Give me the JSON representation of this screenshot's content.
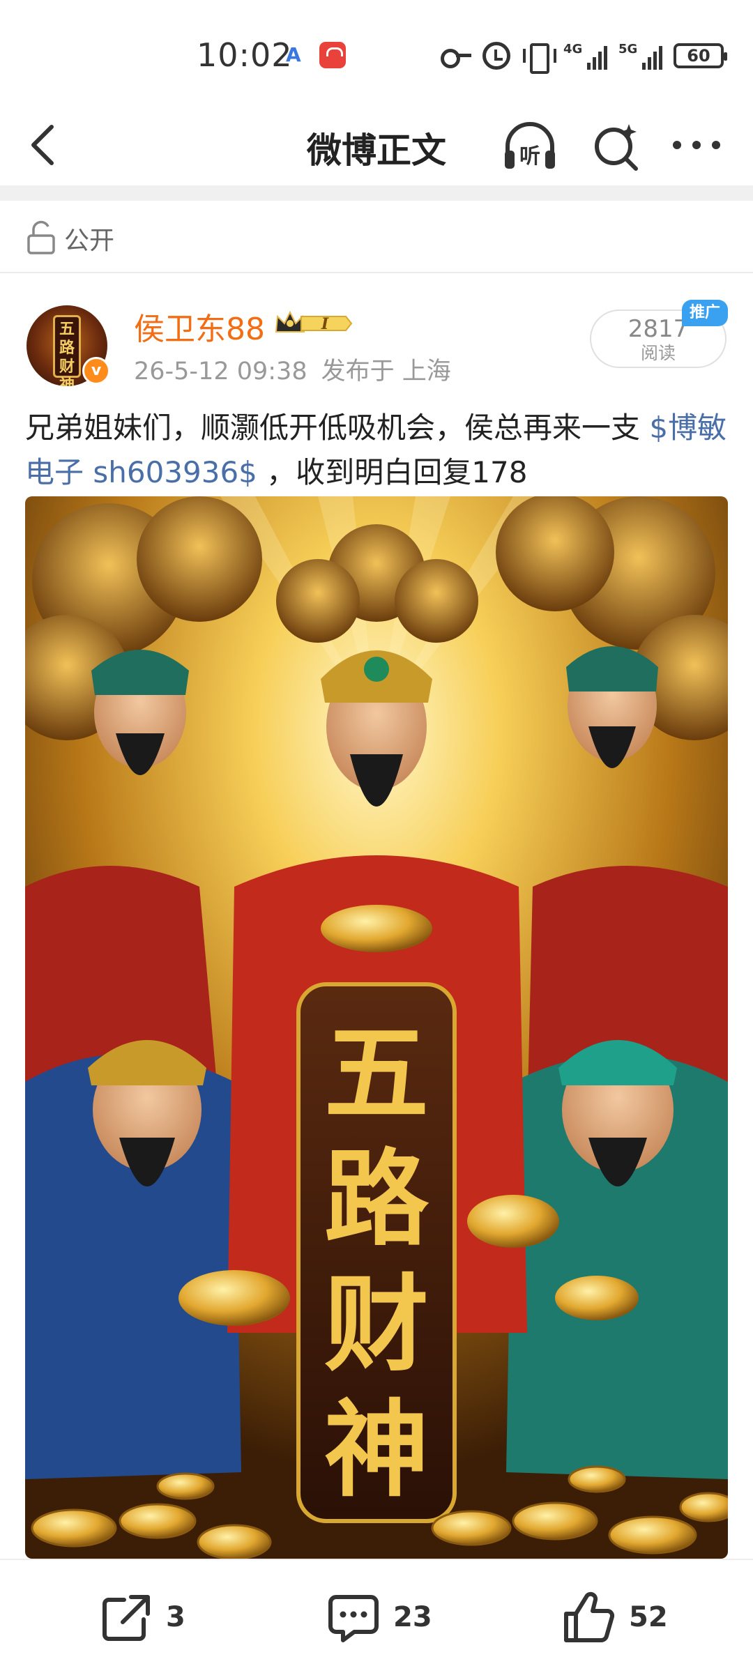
{
  "status_bar": {
    "time": "10:02",
    "app_badge": "A",
    "network_1": "4G",
    "network_2": "5G",
    "battery": "60"
  },
  "nav": {
    "title": "微博正文",
    "listen_icon": "listen-headphones-icon",
    "search_icon": "search-icon",
    "more_icon": "more-icon"
  },
  "visibility": {
    "label": "公开"
  },
  "author": {
    "name": "侯卫东88",
    "avatar_text": "五路财神",
    "vip_level": "I"
  },
  "post": {
    "time": "26-5-12 09:38",
    "location": "发布于 上海",
    "reads_count": "2817",
    "reads_label": "阅读",
    "promo_tag": "推广",
    "text_intro": "兄弟姐妹们，顺灏低开低吸机会，侯总再来一支",
    "stock_tag": "$博敏电子 sh603936$",
    "text_outro": " ，收到明白回复178",
    "image_caption_chars": [
      "五",
      "路",
      "财",
      "神"
    ]
  },
  "actions": {
    "share_count": "3",
    "comment_count": "23",
    "like_count": "52"
  },
  "colors": {
    "author_name": "#f26d14",
    "link": "#4a6ea8",
    "promo": "#3aa0f0",
    "gold": "#e8b84a"
  }
}
